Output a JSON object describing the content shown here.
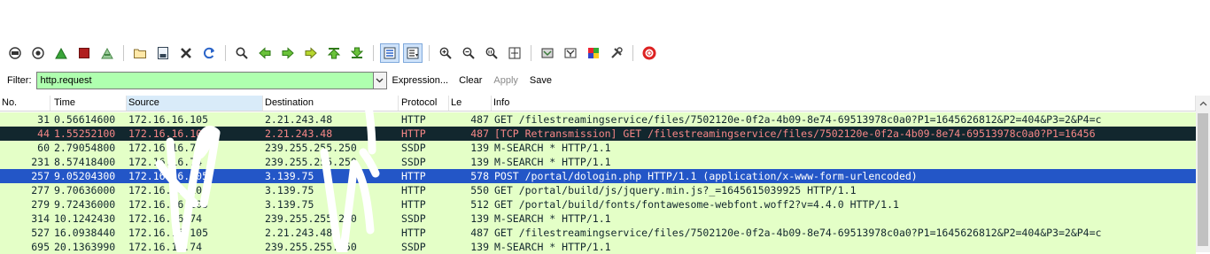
{
  "toolbar": {
    "icons": [
      "interface-list-icon",
      "capture-options-icon",
      "start-capture-icon",
      "stop-capture-icon",
      "restart-capture-icon",
      "open-file-icon",
      "save-file-icon",
      "close-file-icon",
      "reload-icon",
      "find-packet-icon",
      "go-back-icon",
      "go-forward-icon",
      "go-to-packet-icon",
      "go-first-icon",
      "go-last-icon",
      "colorize-icon",
      "autoscroll-icon",
      "zoom-in-icon",
      "zoom-out-icon",
      "normal-size-icon",
      "resize-columns-icon",
      "capture-filters-icon",
      "display-filters-icon",
      "coloring-rules-icon",
      "preferences-icon",
      "help-icon"
    ]
  },
  "filter": {
    "label": "Filter:",
    "value": "http.request",
    "expression": "Expression...",
    "clear": "Clear",
    "apply": "Apply",
    "save": "Save"
  },
  "columns": {
    "no": "No.",
    "time": "Time",
    "source": "Source",
    "destination": "Destination",
    "protocol": "Protocol",
    "length": "Le",
    "info": "Info"
  },
  "colors": {
    "http_row": "#e4ffc7",
    "ssdp_row": "#daeeff",
    "selected_row": "#2356c7",
    "bad_tcp_bg": "#12272e",
    "bad_tcp_fg": "#f78787",
    "filter_ok": "#afffaf"
  },
  "packets": [
    {
      "no": "31",
      "time": "0.56614600",
      "source": "172.16.16.105",
      "destination": "2.21.243.48",
      "protocol": "HTTP",
      "length": "487",
      "info": "GET /filestreamingservice/files/7502120e-0f2a-4b09-8e74-69513978c0a0?P1=1645626812&P2=404&P3=2&P4=c",
      "style": "http"
    },
    {
      "no": "44",
      "time": "1.55252100",
      "source": "172.16.16.105",
      "destination": "2.21.243.48",
      "protocol": "HTTP",
      "length": "487",
      "info": "[TCP Retransmission] GET /filestreamingservice/files/7502120e-0f2a-4b09-8e74-69513978c0a0?P1=16456",
      "style": "bad"
    },
    {
      "no": "60",
      "time": "2.79054800",
      "source": "172.16.16.74",
      "destination": "239.255.255.250",
      "protocol": "SSDP",
      "length": "139",
      "info": "M-SEARCH * HTTP/1.1",
      "style": "http"
    },
    {
      "no": "231",
      "time": "8.57418400",
      "source": "172.16.16.74",
      "destination": "239.255.255.250",
      "protocol": "SSDP",
      "length": "139",
      "info": "M-SEARCH * HTTP/1.1",
      "style": "http"
    },
    {
      "no": "257",
      "time": "9.05204300",
      "source": "172.16.16.105",
      "destination": "3.139.75",
      "protocol": "HTTP",
      "length": "578",
      "info": "POST /portal/dologin.php HTTP/1.1  (application/x-www-form-urlencoded)",
      "style": "selected"
    },
    {
      "no": "277",
      "time": "9.70636000",
      "source": "172.16.16.105",
      "destination": "3.139.75",
      "protocol": "HTTP",
      "length": "550",
      "info": "GET /portal/build/js/jquery.min.js?_=1645615039925 HTTP/1.1",
      "style": "http"
    },
    {
      "no": "279",
      "time": "9.72436000",
      "source": "172.16.16.105",
      "destination": "3.139.75",
      "protocol": "HTTP",
      "length": "512",
      "info": "GET /portal/build/fonts/fontawesome-webfont.woff2?v=4.4.0 HTTP/1.1",
      "style": "http"
    },
    {
      "no": "314",
      "time": "10.1242430",
      "source": "172.16.16.74",
      "destination": "239.255.255.250",
      "protocol": "SSDP",
      "length": "139",
      "info": "M-SEARCH * HTTP/1.1",
      "style": "http"
    },
    {
      "no": "527",
      "time": "16.0938440",
      "source": "172.16.16.105",
      "destination": "2.21.243.48",
      "protocol": "HTTP",
      "length": "487",
      "info": "GET /filestreamingservice/files/7502120e-0f2a-4b09-8e74-69513978c0a0?P1=1645626812&P2=404&P3=2&P4=c",
      "style": "http"
    },
    {
      "no": "695",
      "time": "20.1363990",
      "source": "172.16.16.74",
      "destination": "239.255.255.250",
      "protocol": "SSDP",
      "length": "139",
      "info": "M-SEARCH * HTTP/1.1",
      "style": "http"
    }
  ]
}
